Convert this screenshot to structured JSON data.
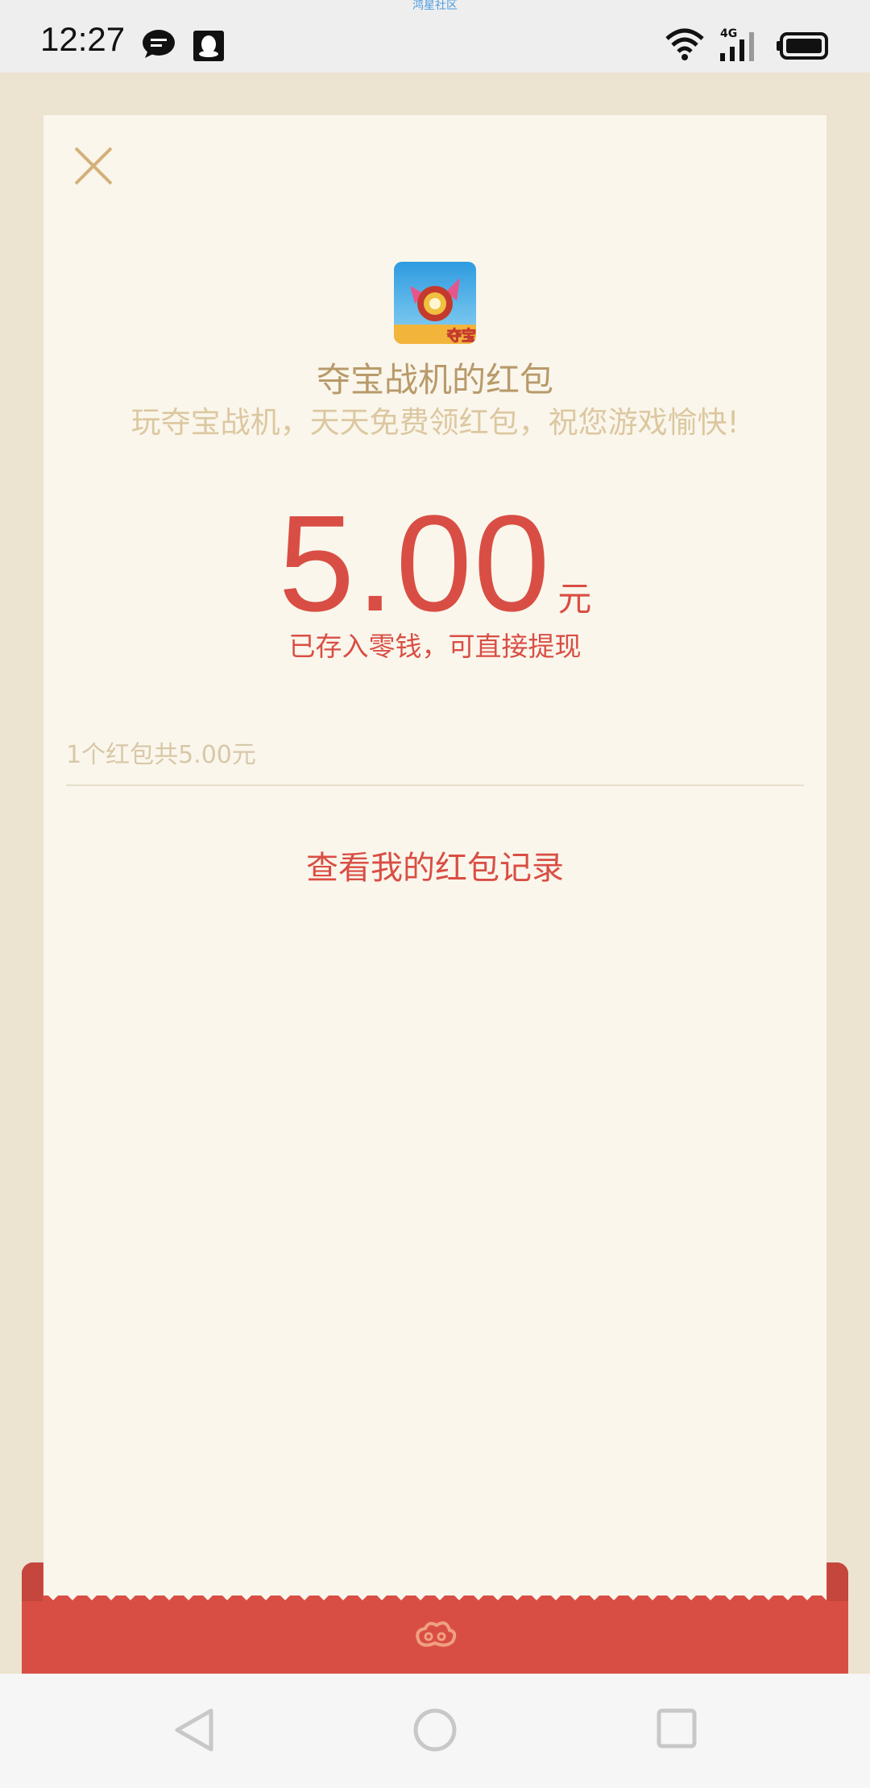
{
  "status_bar": {
    "top_label": "鸿星社区",
    "time": "12:27",
    "network_label": "4G"
  },
  "card": {
    "title": "夺宝战机的红包",
    "subtitle": "玩夺宝战机，天天免费领红包，祝您游戏愉快!",
    "app_icon_text": "夺宝",
    "amount": "5.00",
    "unit": "元",
    "stored_note": "已存入零钱，可直接提现",
    "count_text": "1个红包共5.00元",
    "records_link": "查看我的红包记录"
  },
  "colors": {
    "accent_red": "#D94E44",
    "gold_text": "#B89A6A",
    "card_bg": "#FAF6EC",
    "page_bg": "#ECE3D0"
  }
}
